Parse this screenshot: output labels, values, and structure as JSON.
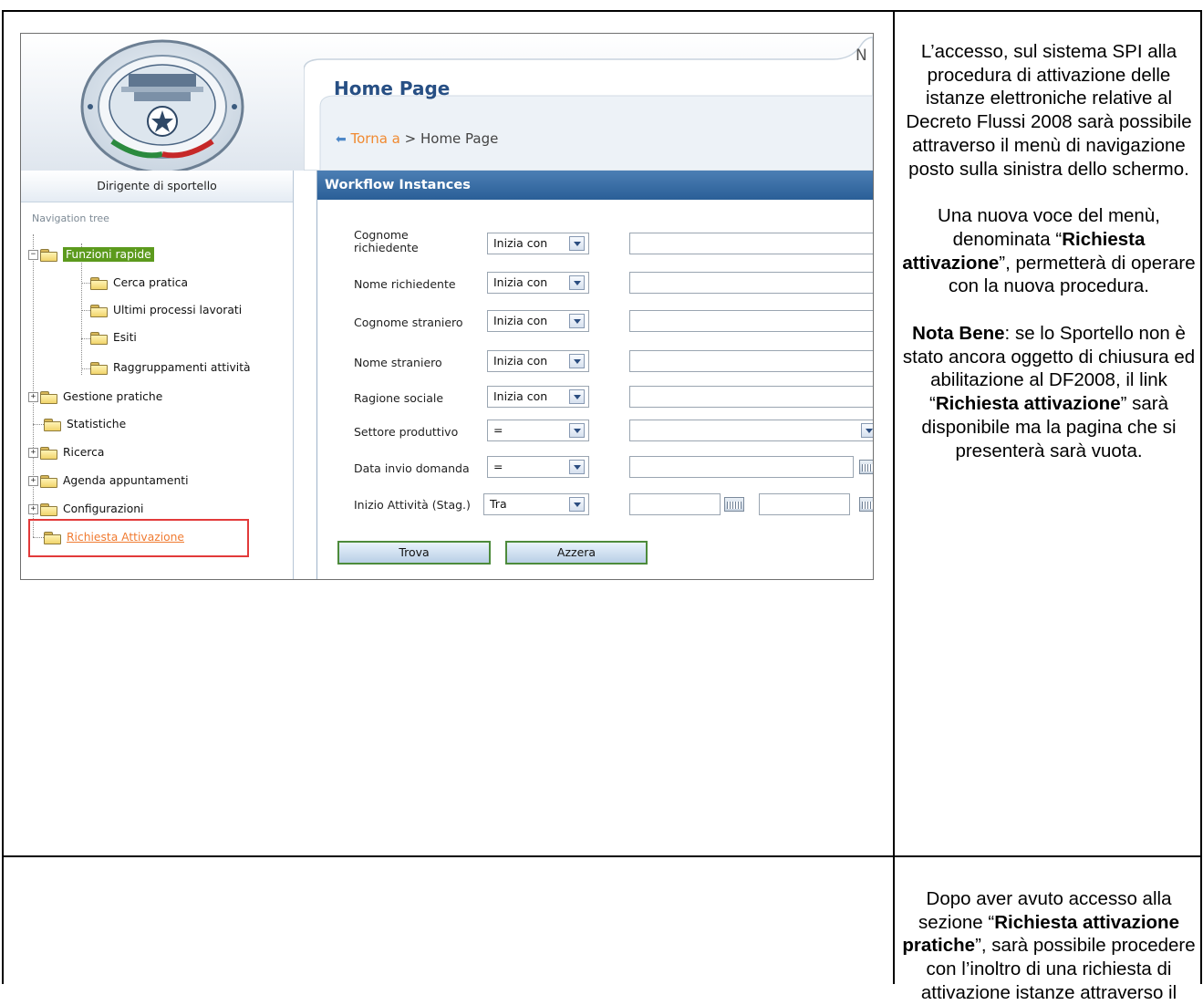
{
  "screenshot": {
    "role": "Dirigente di sportello",
    "nav_title": "Navigation tree",
    "top_right_fragment": "N",
    "page_title": "Home Page",
    "breadcrumb": {
      "back": "Torna a",
      "sep": " > ",
      "current": "Home Page"
    },
    "panel_title": "Workflow Instances",
    "tree": [
      {
        "label": "Funzioni rapide"
      },
      {
        "label": "Cerca pratica"
      },
      {
        "label": "Ultimi processi lavorati"
      },
      {
        "label": "Esiti"
      },
      {
        "label": "Raggruppamenti attività"
      },
      {
        "label": "Gestione pratiche"
      },
      {
        "label": "Statistiche"
      },
      {
        "label": "Ricerca"
      },
      {
        "label": "Agenda appuntamenti"
      },
      {
        "label": "Configurazioni"
      },
      {
        "label": "Richiesta Attivazione"
      }
    ],
    "form": [
      {
        "label1": "Cognome",
        "label2": "richiedente",
        "op": "Inizia con"
      },
      {
        "label": "Nome richiedente",
        "op": "Inizia con"
      },
      {
        "label": "Cognome straniero",
        "op": "Inizia con"
      },
      {
        "label": "Nome straniero",
        "op": "Inizia con"
      },
      {
        "label": "Ragione sociale",
        "op": "Inizia con"
      },
      {
        "label": "Settore produttivo",
        "op": "="
      },
      {
        "label": "Data invio domanda",
        "op": "="
      },
      {
        "label": "Inizio Attività (Stag.)",
        "op": "Tra"
      }
    ],
    "buttons": {
      "search": "Trova",
      "reset": "Azzera"
    }
  },
  "text1": {
    "p1": "L’accesso, sul sistema SPI  alla procedura di attivazione delle istanze elettroniche relative al Decreto Flussi 2008 sarà possibile attraverso il menù di navigazione posto sulla sinistra dello schermo.",
    "p2_a": "Una nuova voce del menù, denominata “",
    "p2_b": "Richiesta attivazione",
    "p2_c": "”, permetterà di operare con la nuova procedura.",
    "p3_a": "Nota Bene",
    "p3_b": ": se lo Sportello non è stato ancora oggetto di chiusura ed abilitazione al DF2008, il link “",
    "p3_c": "Richiesta attivazione",
    "p3_d": "” sarà disponibile ma la pagina che si presenterà sarà vuota."
  },
  "text2": {
    "a": "Dopo aver avuto accesso alla sezione “",
    "b": "Richiesta attivazione pratiche",
    "c": "”, sarà possibile procedere con l’inoltro di una richiesta di attivazione istanze attraverso il"
  }
}
